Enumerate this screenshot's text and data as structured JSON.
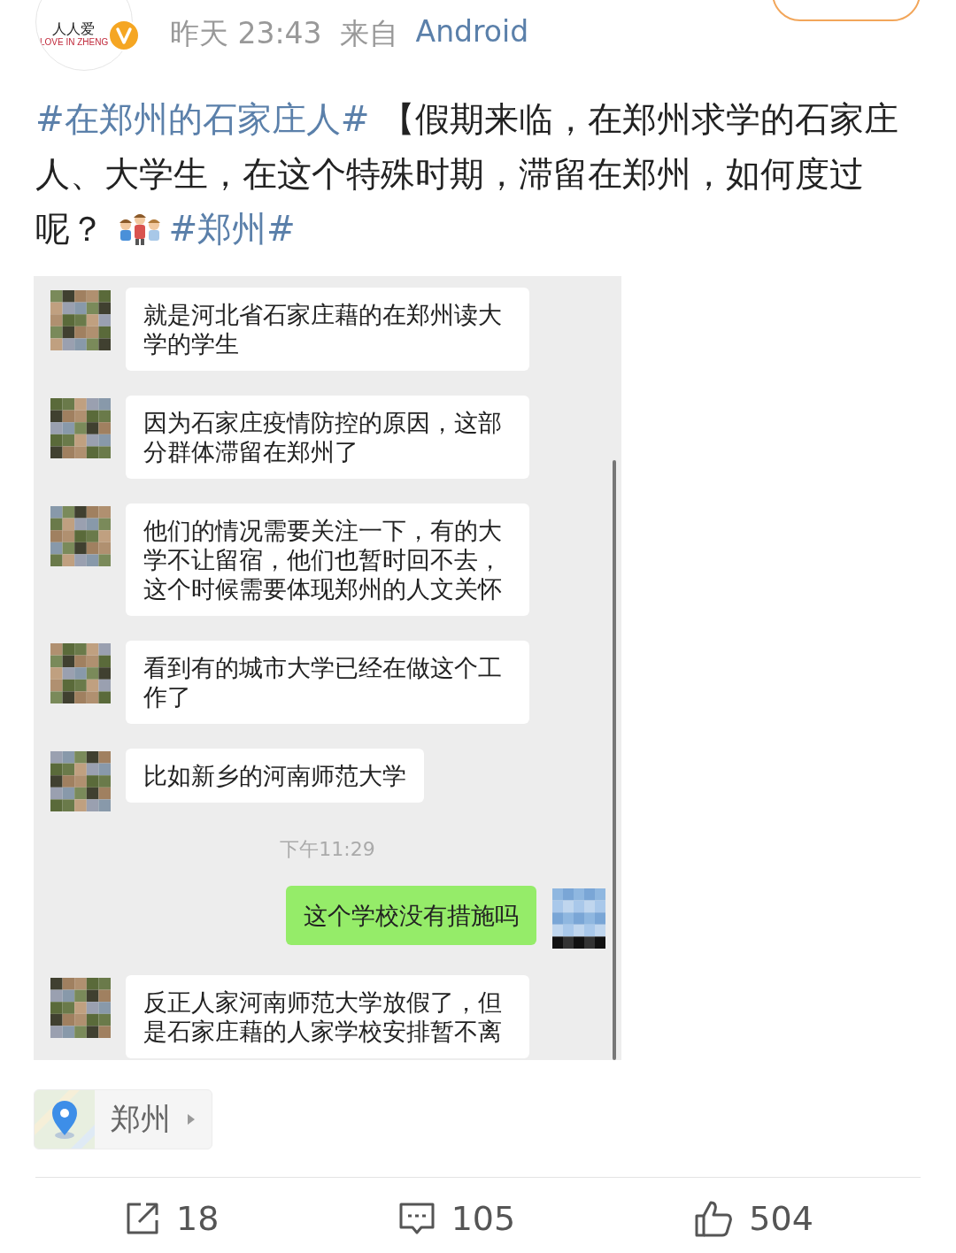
{
  "author": {
    "logo_text": "人人爱",
    "logo_subtext": "LOVE IN ZHENG",
    "verified": true
  },
  "meta": {
    "time": "昨天 23:43",
    "source_prefix": "来自",
    "source": "Android"
  },
  "post": [
    {
      "kind": "tag",
      "text": "#在郑州的石家庄人#"
    },
    {
      "kind": "text",
      "text": " 【假期来临，在郑州求学的石家庄人、大学生，在这个特殊时期，滞留在郑州，如何度过呢？ "
    },
    {
      "kind": "emoji"
    },
    {
      "kind": "tag",
      "text": "#郑州#"
    }
  ],
  "chat": [
    {
      "kind": "received",
      "text": "就是河北省石家庄藉的在郑州读大学的学生"
    },
    {
      "kind": "received",
      "text": "因为石家庄疫情防控的原因，这部分群体滞留在郑州了"
    },
    {
      "kind": "received",
      "text": "他们的情况需要关注一下，有的大学不让留宿，他们也暂时回不去，这个时候需要体现郑州的人文关怀"
    },
    {
      "kind": "received",
      "text": "看到有的城市大学已经在做这个工作了"
    },
    {
      "kind": "received",
      "text": "比如新乡的河南师范大学"
    },
    {
      "kind": "time",
      "text": "下午11:29"
    },
    {
      "kind": "sent",
      "text": "这个学校没有措施吗"
    },
    {
      "kind": "received",
      "text": "反正人家河南师范大学放假了，但是石家庄藉的人家学校安排暂不离"
    }
  ],
  "location": {
    "label": "郑州"
  },
  "actions": [
    {
      "kind": "repost",
      "count": "18"
    },
    {
      "kind": "comment",
      "count": "105"
    },
    {
      "kind": "like",
      "count": "504"
    }
  ]
}
